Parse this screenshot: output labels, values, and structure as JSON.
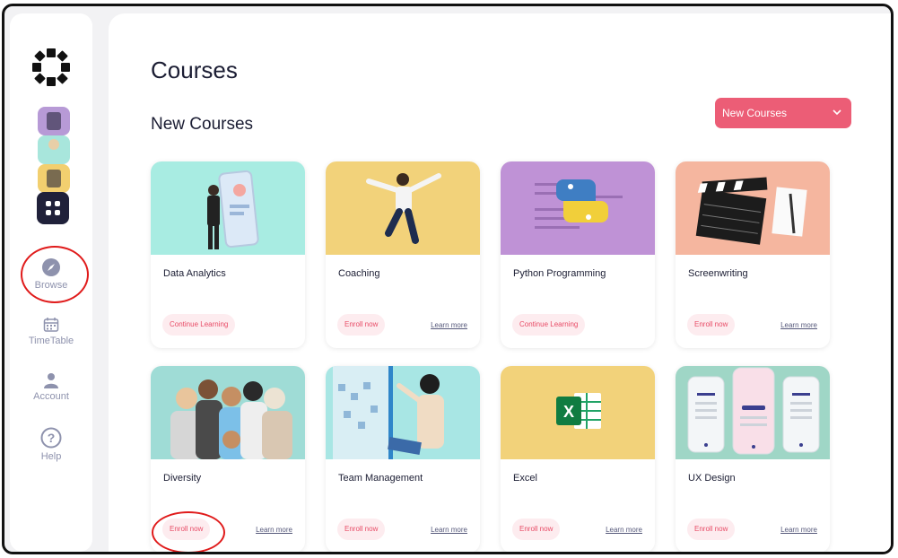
{
  "sidebar": {
    "browse_label": "Browse",
    "timetable_label": "TimeTable",
    "account_label": "Account",
    "help_label": "Help"
  },
  "main": {
    "title": "Courses",
    "section_title": "New Courses",
    "filter": {
      "selected": "New Courses"
    }
  },
  "colors": {
    "accent": "#ec5d76",
    "badge_bg": "#fdecef",
    "dark": "#20213a"
  },
  "courses": [
    {
      "name": "Data Analytics",
      "action": "Continue Learning",
      "learn": "",
      "bg": "#a8ece2"
    },
    {
      "name": "Coaching",
      "action": "Enroll now",
      "learn": "Learn more",
      "bg": "#f2d27a"
    },
    {
      "name": "Python Programming",
      "action": "Continue Learning",
      "learn": "",
      "bg": "#bf92d6"
    },
    {
      "name": "Screenwriting",
      "action": "Enroll now",
      "learn": "Learn more",
      "bg": "#f5b69f"
    },
    {
      "name": "Diversity",
      "action": "Enroll now",
      "learn": "Learn more",
      "bg": "#9fdcd6"
    },
    {
      "name": "Team Management",
      "action": "Enroll now",
      "learn": "Learn more",
      "bg": "#a8e6e4"
    },
    {
      "name": "Excel",
      "action": "Enroll now",
      "learn": "Learn more",
      "bg": "#f2d27a"
    },
    {
      "name": "UX Design",
      "action": "Enroll now",
      "learn": "Learn more",
      "bg": "#9fd6c6"
    }
  ]
}
